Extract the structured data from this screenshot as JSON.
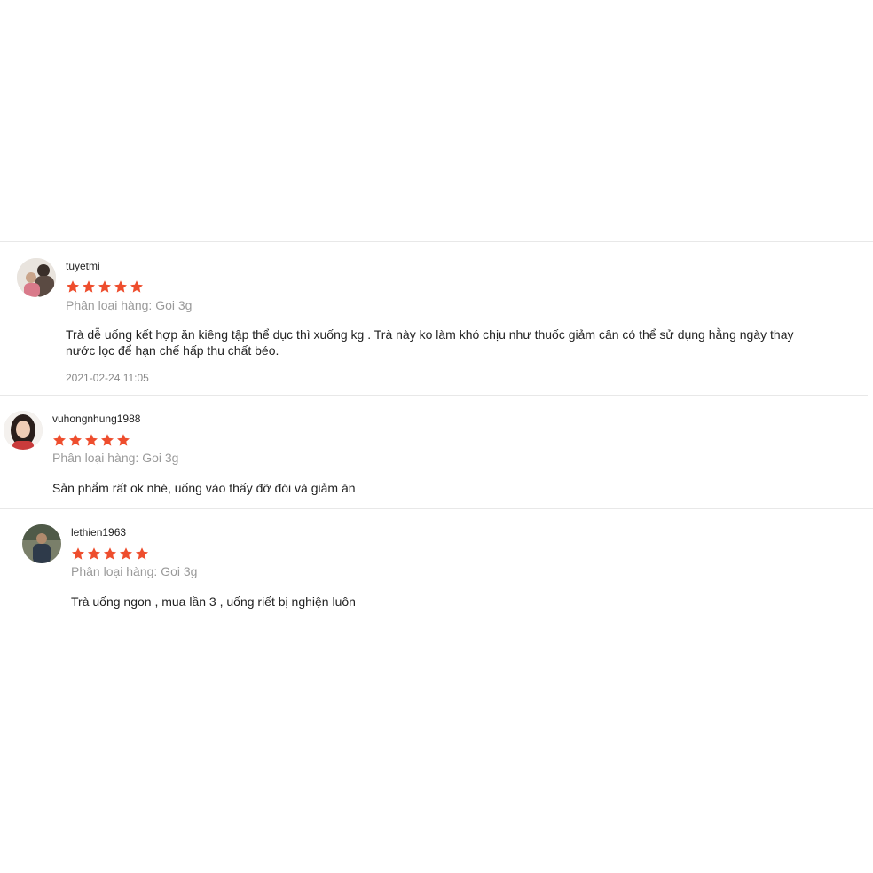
{
  "star_color": "#ee4d2d",
  "reviews": [
    {
      "username": "tuyetmi",
      "rating": 5,
      "variation": "Phân loại hàng: Goi 3g",
      "comment": "Trà dễ uống kết hợp ăn kiêng tập thể dục thì xuống kg . Trà này ko làm khó chịu như thuốc giảm cân có thể sử dụng hằng ngày thay\nnước lọc để hạn chế hấp thu chất béo.",
      "time": "2021-02-24 11:05"
    },
    {
      "username": "vuhongnhung1988",
      "rating": 5,
      "variation": "Phân loại hàng: Goi 3g",
      "comment": "Sản phẩm rất ok nhé, uống vào thấy đỡ đói và giảm ăn"
    },
    {
      "username": "lethien1963",
      "rating": 5,
      "variation": "Phân loại hàng: Goi 3g",
      "comment": "Trà uống ngon , mua lần 3 , uống riết bị nghiện luôn"
    }
  ]
}
